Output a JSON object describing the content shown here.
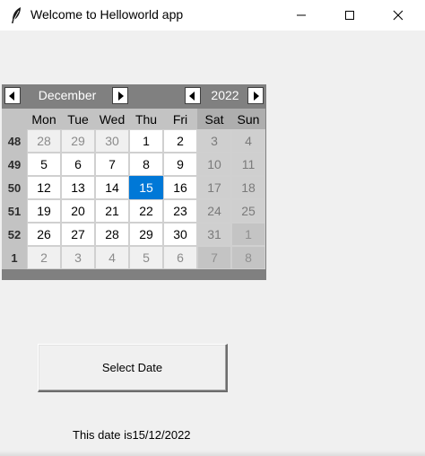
{
  "window": {
    "title": "Welcome to Helloworld app",
    "icon": "feather-icon"
  },
  "calendar": {
    "month": "December",
    "year": "2022",
    "weekday_headers": [
      "Mon",
      "Tue",
      "Wed",
      "Thu",
      "Fri",
      "Sat",
      "Sun"
    ],
    "weeks": [
      {
        "week": "48",
        "days": [
          "28",
          "29",
          "30",
          "1",
          "2",
          "3",
          "4"
        ]
      },
      {
        "week": "49",
        "days": [
          "5",
          "6",
          "7",
          "8",
          "9",
          "10",
          "11"
        ]
      },
      {
        "week": "50",
        "days": [
          "12",
          "13",
          "14",
          "15",
          "16",
          "17",
          "18"
        ]
      },
      {
        "week": "51",
        "days": [
          "19",
          "20",
          "21",
          "22",
          "23",
          "24",
          "25"
        ]
      },
      {
        "week": "52",
        "days": [
          "26",
          "27",
          "28",
          "29",
          "30",
          "31",
          "1"
        ]
      },
      {
        "week": "1",
        "days": [
          "2",
          "3",
          "4",
          "5",
          "6",
          "7",
          "8"
        ]
      }
    ],
    "selected_day": "15",
    "colors": {
      "header_bg": "#808080",
      "selected": "#0078d7"
    }
  },
  "select_button": {
    "label": "Select Date"
  },
  "status": {
    "text": "This date is15/12/2022"
  }
}
